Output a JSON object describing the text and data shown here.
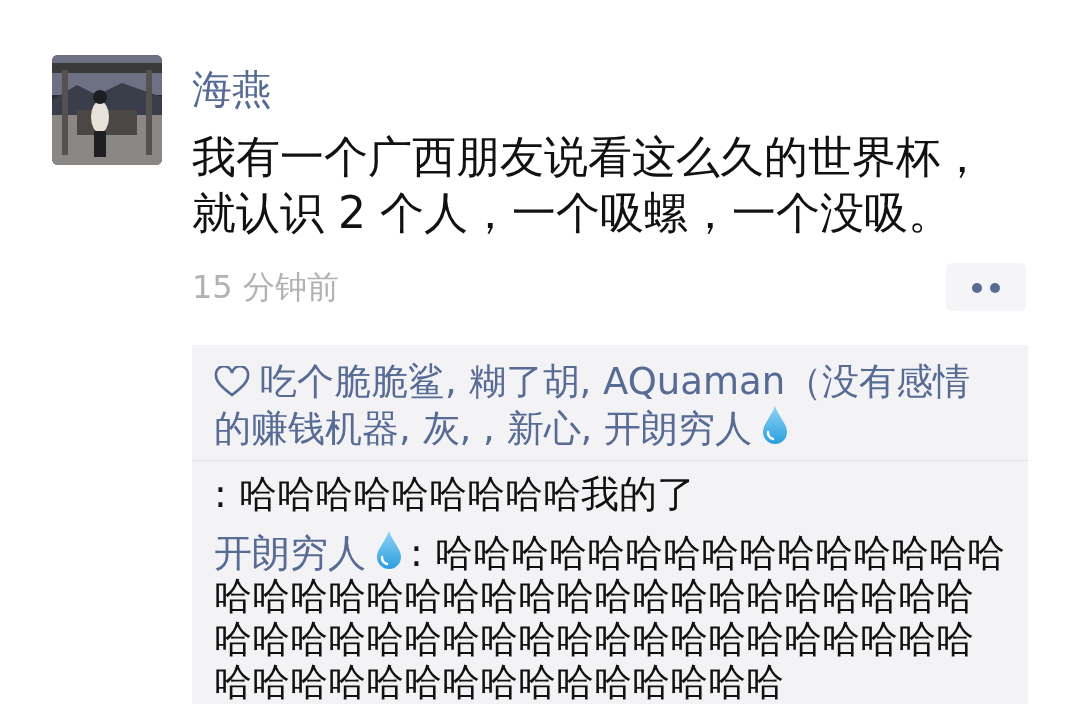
{
  "post": {
    "author": "海燕",
    "text": "我有一个广西朋友说看这么久的世界杯，就认识 2 个人，一个吸螺，一个没吸。",
    "time": "15 分钟前"
  },
  "likes": {
    "names": "吃个脆脆鲨, 糊了胡, AQuaman（没有感情的赚钱机器, 灰, , 新心, 开朗穷人",
    "drop_icon": true
  },
  "comments": [
    {
      "text": ": 哈哈哈哈哈哈哈哈哈我的了",
      "drop_icon": false
    },
    {
      "author": "开朗穷人",
      "text": ": 哈哈哈哈哈哈哈哈哈哈哈哈哈哈哈哈哈哈哈哈哈哈哈哈哈哈哈哈哈哈哈哈哈哈哈哈哈哈哈哈哈哈哈哈哈哈哈哈哈哈哈哈哈哈哈哈哈哈哈哈哈哈哈哈哈哈哈哈哈哈",
      "drop_icon": true
    }
  ]
}
